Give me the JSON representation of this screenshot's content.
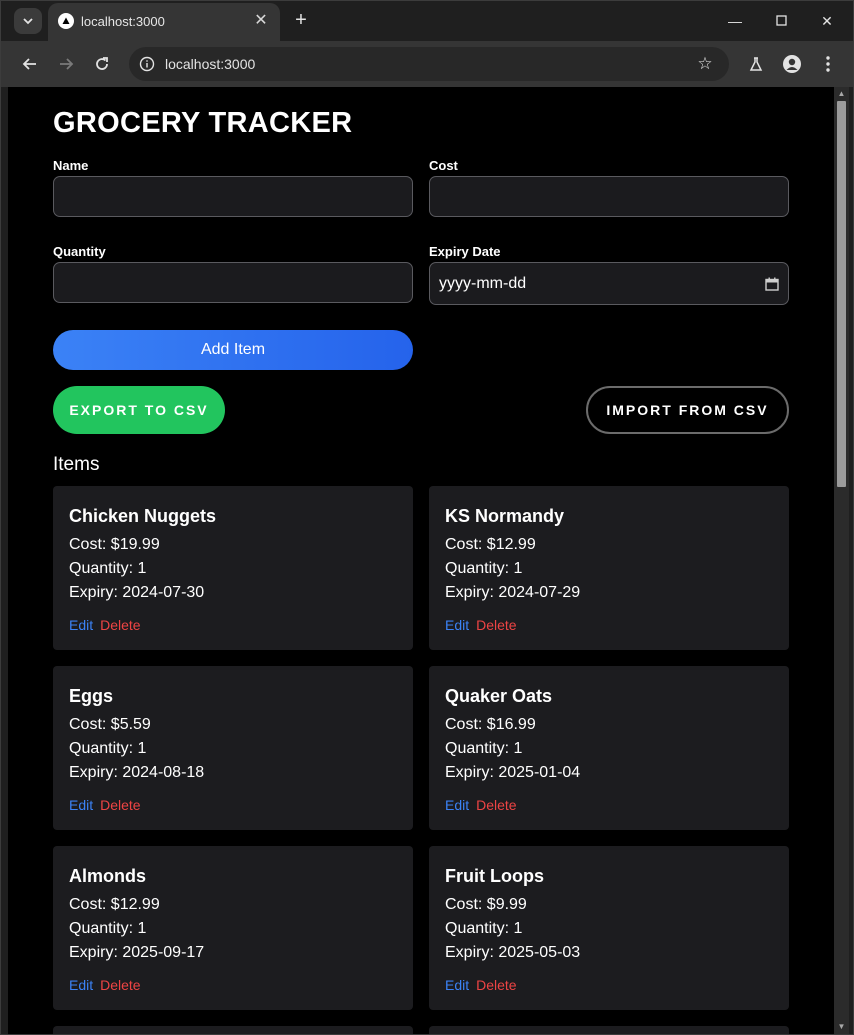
{
  "browser": {
    "tab_title": "localhost:3000",
    "url": "localhost:3000"
  },
  "app": {
    "title": "GROCERY TRACKER",
    "form": {
      "name_label": "Name",
      "name_value": "",
      "cost_label": "Cost",
      "cost_value": "",
      "quantity_label": "Quantity",
      "quantity_value": "",
      "expiry_label": "Expiry Date",
      "expiry_placeholder": "yyyy-mm-dd",
      "add_button": "Add Item"
    },
    "export_button": "EXPORT TO CSV",
    "import_button": "IMPORT FROM CSV",
    "items_heading": "Items",
    "edit_label": "Edit",
    "delete_label": "Delete",
    "items": [
      {
        "name": "Chicken Nuggets",
        "cost": "Cost: $19.99",
        "quantity": "Quantity: 1",
        "expiry": "Expiry: 2024-07-30"
      },
      {
        "name": "KS Normandy",
        "cost": "Cost: $12.99",
        "quantity": "Quantity: 1",
        "expiry": "Expiry: 2024-07-29"
      },
      {
        "name": "Eggs",
        "cost": "Cost: $5.59",
        "quantity": "Quantity: 1",
        "expiry": "Expiry: 2024-08-18"
      },
      {
        "name": "Quaker Oats",
        "cost": "Cost: $16.99",
        "quantity": "Quantity: 1",
        "expiry": "Expiry: 2025-01-04"
      },
      {
        "name": "Almonds",
        "cost": "Cost: $12.99",
        "quantity": "Quantity: 1",
        "expiry": "Expiry: 2025-09-17"
      },
      {
        "name": "Fruit Loops",
        "cost": "Cost: $9.99",
        "quantity": "Quantity: 1",
        "expiry": "Expiry: 2025-05-03"
      }
    ]
  },
  "colors": {
    "page_bg": "#000000",
    "card_bg": "#1c1c1f",
    "add_button": "#3b82f6",
    "export_button": "#22c55e",
    "edit_link": "#3b82f6",
    "delete_link": "#ef4444"
  }
}
